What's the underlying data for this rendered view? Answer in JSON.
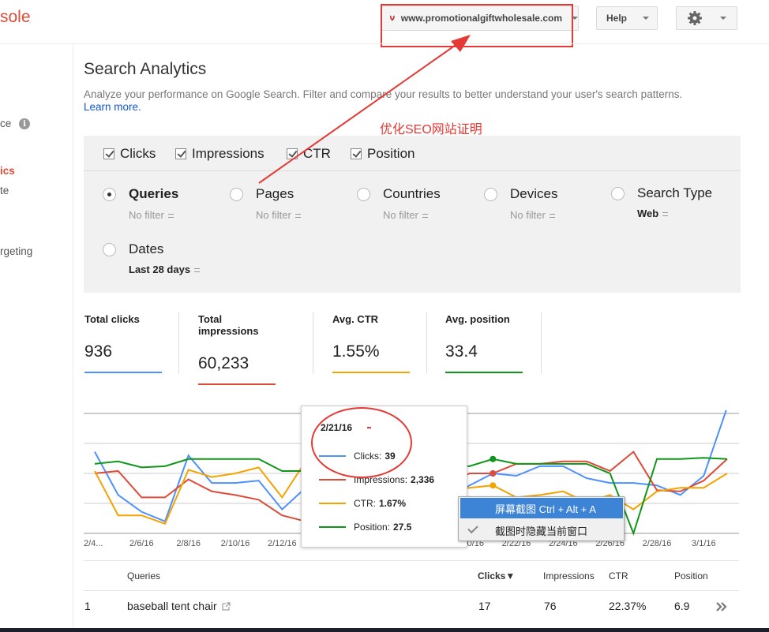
{
  "header": {
    "brand_fragment": "sole",
    "site_name": "www.promotionalgiftwholesale.com",
    "help_label": "Help"
  },
  "sidebar": {
    "items": [
      {
        "label": "ce",
        "active": false
      },
      {
        "label": "ics",
        "active": true
      },
      {
        "label": "te",
        "active": false
      },
      {
        "label": "rgeting",
        "active": false
      }
    ]
  },
  "page": {
    "title": "Search Analytics",
    "description": "Analyze your performance on Google Search. Filter and compare your results to better understand your user's search patterns.",
    "learn_more": "Learn more.",
    "annotation": "优化SEO网站证明"
  },
  "metrics_toggles": [
    {
      "label": "Clicks",
      "checked": true
    },
    {
      "label": "Impressions",
      "checked": true
    },
    {
      "label": "CTR",
      "checked": true
    },
    {
      "label": "Position",
      "checked": true
    }
  ],
  "groupings": [
    {
      "label": "Queries",
      "filter": "No filter",
      "selected": true
    },
    {
      "label": "Pages",
      "filter": "No filter",
      "selected": false
    },
    {
      "label": "Countries",
      "filter": "No filter",
      "selected": false
    },
    {
      "label": "Devices",
      "filter": "No filter",
      "selected": false
    },
    {
      "label": "Search Type",
      "filter": "Web",
      "selected": false
    },
    {
      "label": "Dates",
      "filter": "Last 28 days",
      "selected": false
    }
  ],
  "totals": [
    {
      "label": "Total clicks",
      "value": "936",
      "color": "#4d90fe"
    },
    {
      "label": "Total impressions",
      "value": "60,233",
      "color": "#dd4b39"
    },
    {
      "label": "Avg. CTR",
      "value": "1.55%",
      "color": "#f4a300"
    },
    {
      "label": "Avg. position",
      "value": "33.4",
      "color": "#109618"
    }
  ],
  "chart_data": {
    "type": "line",
    "x": [
      "2/4/16",
      "2/5/16",
      "2/6/16",
      "2/7/16",
      "2/8/16",
      "2/9/16",
      "2/10/16",
      "2/11/16",
      "2/12/16",
      "2/13/16",
      "2/14/16",
      "2/15/16",
      "2/16/16",
      "2/17/16",
      "2/18/16",
      "2/19/16",
      "2/20/16",
      "2/21/16",
      "2/22/16",
      "2/23/16",
      "2/24/16",
      "2/25/16",
      "2/26/16",
      "2/27/16",
      "2/28/16",
      "2/29/16",
      "3/1/16",
      "3/2/16"
    ],
    "tick_labels": [
      "2/4...",
      "2/6/16",
      "2/8/16",
      "2/10/16",
      "2/12/16",
      "",
      "2/16/16",
      "",
      "2/20/16",
      "2/22/16",
      "2/24/16",
      "2/26/16",
      "2/28/16",
      "3/1/16"
    ],
    "tick_indices": [
      0,
      2,
      4,
      6,
      8,
      10,
      12,
      14,
      16,
      18,
      20,
      22,
      24,
      26
    ],
    "series": [
      {
        "name": "Clicks",
        "color": "#4d90fe",
        "values": [
          0.68,
          0.32,
          0.18,
          0.1,
          0.65,
          0.42,
          0.42,
          0.44,
          0.2,
          0.38,
          0.4,
          0.4,
          0.4,
          0.4,
          0.3,
          0.28,
          0.4,
          0.5,
          0.48,
          0.56,
          0.56,
          0.46,
          0.42,
          0.42,
          0.4,
          0.32,
          0.48,
          1.05
        ]
      },
      {
        "name": "Impressions",
        "color": "#dd4b39",
        "values": [
          0.5,
          0.52,
          0.3,
          0.3,
          0.45,
          0.35,
          0.32,
          0.28,
          0.15,
          0.1,
          0.12,
          0.12,
          0.14,
          0.16,
          0.3,
          0.4,
          0.5,
          0.5,
          0.58,
          0.58,
          0.6,
          0.6,
          0.52,
          0.68,
          0.36,
          0.35,
          0.44,
          0.62
        ]
      },
      {
        "name": "CTR",
        "color": "#f4a300",
        "values": [
          0.52,
          0.15,
          0.15,
          0.08,
          0.53,
          0.47,
          0.5,
          0.55,
          0.3,
          0.6,
          0.6,
          0.6,
          0.6,
          0.6,
          0.4,
          0.35,
          0.38,
          0.4,
          0.3,
          0.32,
          0.35,
          0.26,
          0.32,
          0.2,
          0.35,
          0.38,
          0.38,
          0.5
        ]
      },
      {
        "name": "Position",
        "color": "#109618",
        "values": [
          0.58,
          0.6,
          0.55,
          0.56,
          0.62,
          0.62,
          0.62,
          0.62,
          0.52,
          0.52,
          0.54,
          0.54,
          0.54,
          0.54,
          0.56,
          0.56,
          0.56,
          0.62,
          0.58,
          0.58,
          0.58,
          0.58,
          0.5,
          0.0,
          0.62,
          0.62,
          0.63,
          0.62
        ]
      }
    ]
  },
  "tooltip": {
    "date": "2/21/16",
    "rows": [
      {
        "name": "Clicks:",
        "value": "39",
        "color": "#4d90fe"
      },
      {
        "name": "Impressions:",
        "value": "2,336",
        "color": "#dd4b39"
      },
      {
        "name": "CTR:",
        "value": "1.67%",
        "color": "#f4a300"
      },
      {
        "name": "Position:",
        "value": "27.5",
        "color": "#109618"
      }
    ]
  },
  "context_menu": {
    "items": [
      {
        "label": "屏幕截图 Ctrl + Alt + A",
        "highlighted": true,
        "checked": false
      },
      {
        "label": "截图时隐藏当前窗口",
        "highlighted": false,
        "checked": true
      }
    ]
  },
  "table": {
    "headers": {
      "queries": "Queries",
      "clicks": "Clicks▼",
      "impressions": "Impressions",
      "ctr": "CTR",
      "position": "Position"
    },
    "rows": [
      {
        "index": "1",
        "query": "baseball tent chair",
        "clicks": "17",
        "impressions": "76",
        "ctr": "22.37%",
        "position": "6.9"
      }
    ]
  }
}
